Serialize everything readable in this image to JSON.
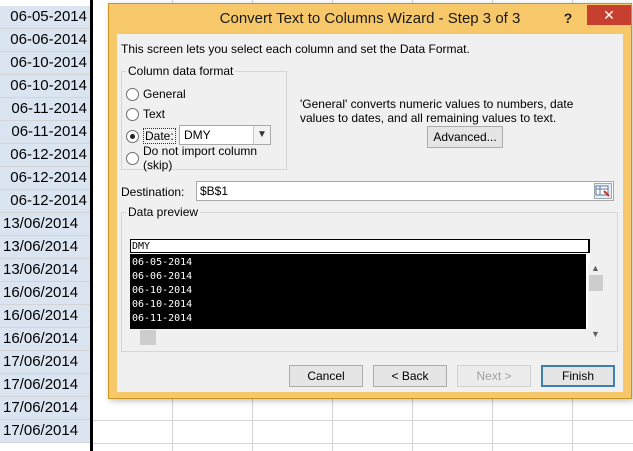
{
  "sheet": {
    "cells": [
      "06-05-2014",
      "06-06-2014",
      "06-10-2014",
      "06-10-2014",
      "06-11-2014",
      "06-11-2014",
      "06-12-2014",
      "06-12-2014",
      "06-12-2014",
      "13/06/2014",
      "13/06/2014",
      "13/06/2014",
      "16/06/2014",
      "16/06/2014",
      "16/06/2014",
      "17/06/2014",
      "17/06/2014",
      "17/06/2014",
      "17/06/2014"
    ]
  },
  "dialog": {
    "title": "Convert Text to Columns Wizard - Step 3 of 3",
    "help_label": "?",
    "close_label": "✕",
    "intro": "This screen lets you select each column and set the Data Format.",
    "format_group": {
      "legend": "Column data format",
      "options": [
        "General",
        "Text",
        "Date:",
        "Do not import column (skip)"
      ],
      "selected": "Date:",
      "date_select_value": "DMY",
      "date_select_arrow": "▼"
    },
    "description": "'General' converts numeric values to numbers, date values to dates, and all remaining values to text.",
    "advanced_button": "Advanced...",
    "destination_label": "Destination:",
    "destination_value": "$B$1",
    "preview": {
      "legend": "Data preview",
      "header": "DMY",
      "rows": [
        "06-05-2014",
        "06-06-2014",
        "06-10-2014",
        "06-10-2014",
        "06-11-2014"
      ],
      "scroll_up": "▲",
      "scroll_down": "▼"
    },
    "buttons": {
      "cancel": "Cancel",
      "back": "< Back",
      "next": "Next >",
      "finish": "Finish"
    }
  }
}
